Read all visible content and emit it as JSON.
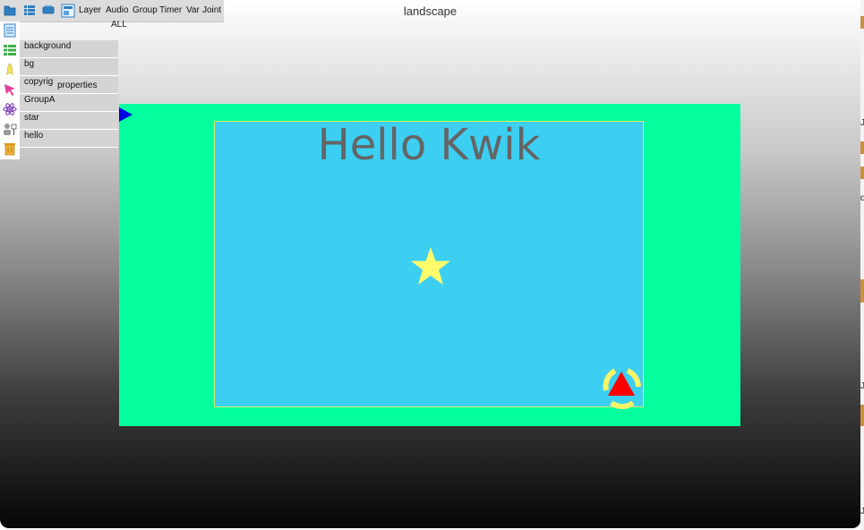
{
  "window": {
    "title": "landscape"
  },
  "toolbar": {
    "menu": [
      "Layer",
      "Audio",
      "Group",
      "Timer",
      "Var",
      "Joint"
    ],
    "filter_label": "ALL",
    "icons": [
      "folder-icon",
      "list-icon",
      "layers-icon",
      "document-icon"
    ]
  },
  "sidebar": {
    "icons": [
      "page-icon",
      "table-icon",
      "rocket-icon",
      "pointer-icon",
      "atom-icon",
      "users-icon",
      "trash-icon"
    ]
  },
  "layers": [
    {
      "name": "background"
    },
    {
      "name": "bg"
    },
    {
      "name": "copyrig"
    },
    {
      "name": "GroupA"
    },
    {
      "name": "star"
    },
    {
      "name": "hello"
    }
  ],
  "properties_label": "properties",
  "canvas": {
    "title_text": "Hello Kwik",
    "stage_color": "#05ff9f",
    "canvas_color": "#3ccff2",
    "star_color": "#fffb6b",
    "arrow_color": "#ff0000"
  },
  "right_edge": {
    "fragments": [
      "J",
      "d",
      "J",
      "J"
    ]
  }
}
